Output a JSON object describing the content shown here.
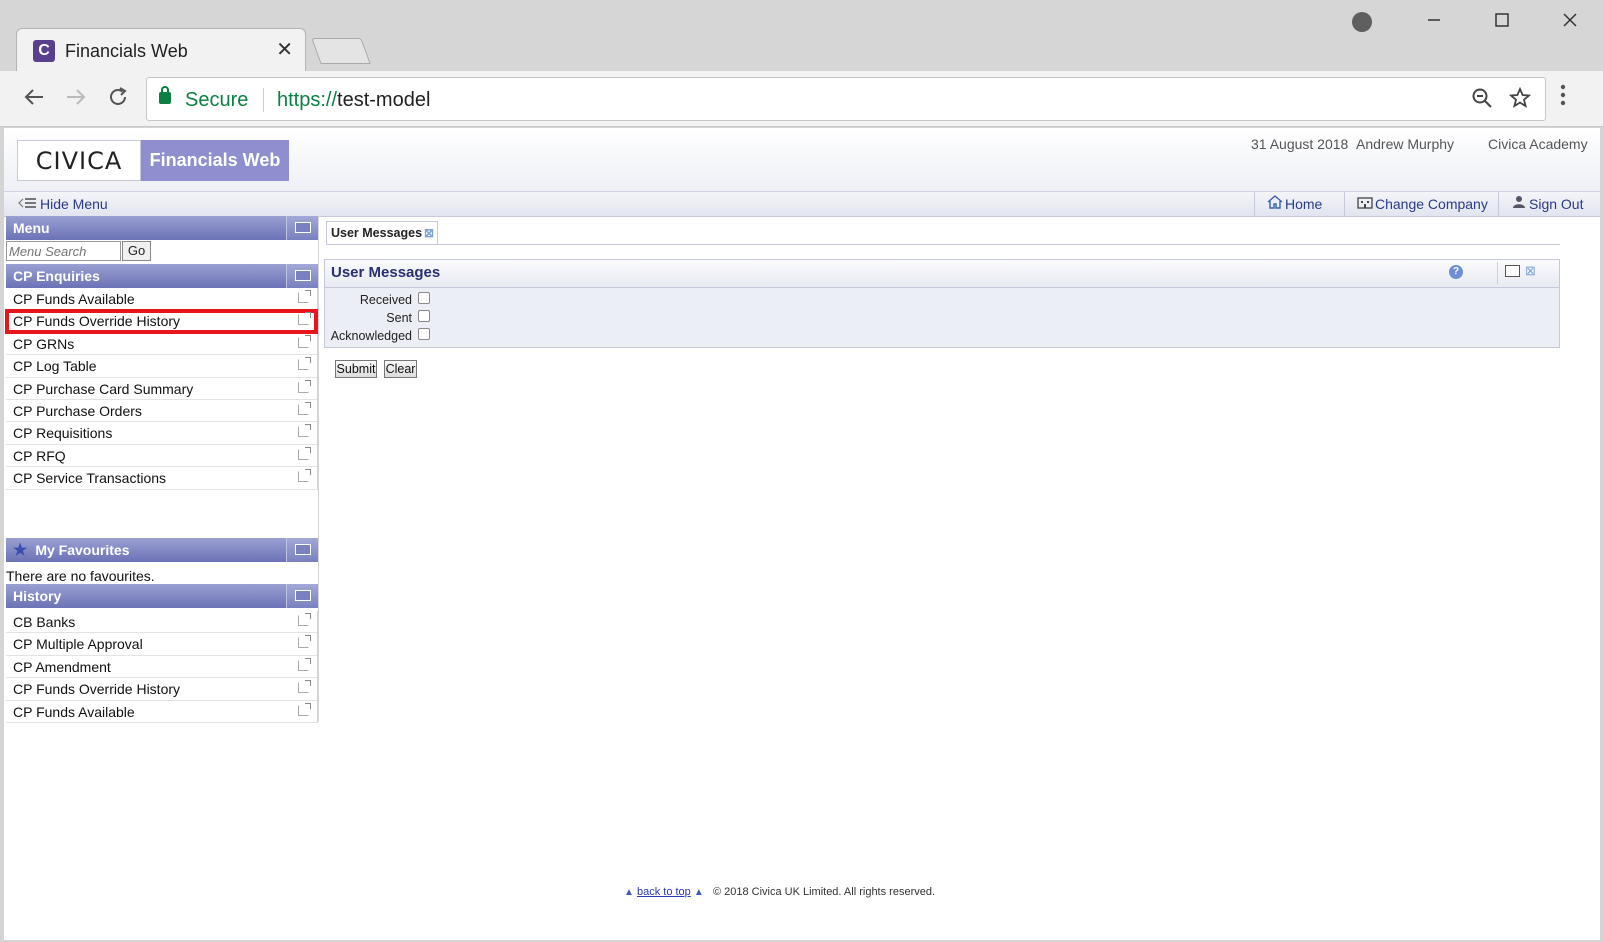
{
  "browser": {
    "tab_title": "Financials Web",
    "favicon_letter": "C",
    "close_glyph": "✕",
    "url_security": "Secure",
    "url_scheme": "https://",
    "url_host": "test-model",
    "icons": [
      "back-arrow-icon",
      "forward-arrow-icon",
      "reload-icon",
      "lock-icon",
      "zoom-out-icon",
      "star-icon",
      "menu-dots-icon",
      "profile-icon",
      "minimize-icon",
      "maximize-icon",
      "close-icon"
    ]
  },
  "header": {
    "logo_text": "CIVICA",
    "product_name": "Financials Web",
    "date": "31 August 2018",
    "user": "Andrew Murphy",
    "organisation": "Civica Academy"
  },
  "menubar": {
    "hide_menu": "Hide Menu",
    "home": "Home",
    "change_company": "Change Company",
    "sign_out": "Sign Out"
  },
  "left": {
    "menu_title": "Menu",
    "search_placeholder": "Menu Search",
    "go_label": "Go",
    "enquiries_title": "CP Enquiries",
    "enquiries": [
      "CP Funds Available",
      "CP Funds Override History",
      "CP GRNs",
      "CP Log Table",
      "CP Purchase Card Summary",
      "CP Purchase Orders",
      "CP Requisitions",
      "CP RFQ",
      "CP Service Transactions"
    ],
    "highlighted_index": 1,
    "favourites_title": "My Favourites",
    "no_favourites": "There are no favourites.",
    "history_title": "History",
    "history": [
      "CB Banks",
      "CP Multiple Approval",
      "CP Amendment",
      "CP Funds Override History",
      "CP Funds Available"
    ]
  },
  "content": {
    "tab_label": "User Messages",
    "panel_title": "User Messages",
    "fields": [
      {
        "label": "Received",
        "checked": false
      },
      {
        "label": "Sent",
        "checked": false
      },
      {
        "label": "Acknowledged",
        "checked": false
      }
    ],
    "submit_label": "Submit",
    "clear_label": "Clear"
  },
  "footer": {
    "back_to_top": "back to top",
    "copyright": "© 2018 Civica UK Limited. All rights reserved."
  },
  "colors": {
    "accent": "#6b72b6",
    "highlight_box": "#e8151c",
    "secure_green": "#0b8043"
  }
}
